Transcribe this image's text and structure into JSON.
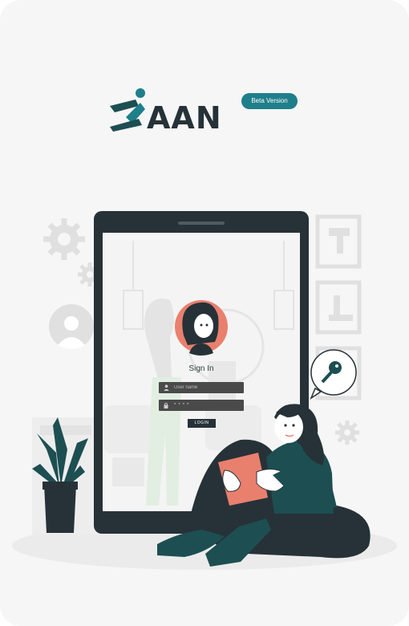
{
  "app": {
    "brand_text": "AAN",
    "badge": "Beta Version"
  },
  "login": {
    "title": "Sign In",
    "username_placeholder": "User name",
    "password_value": "****",
    "login_label": "LOGIN"
  },
  "colors": {
    "background": "#f6f6f6",
    "accent": "#1f7f8b",
    "tablet_frame": "#263238",
    "avatar_bg": "#e9806e",
    "teal_dark": "#1d4e52"
  },
  "icons": {
    "brand": "brand-logo-icon",
    "user": "user-icon",
    "lock": "lock-icon",
    "gear": "gear-icon",
    "key": "key-icon"
  }
}
